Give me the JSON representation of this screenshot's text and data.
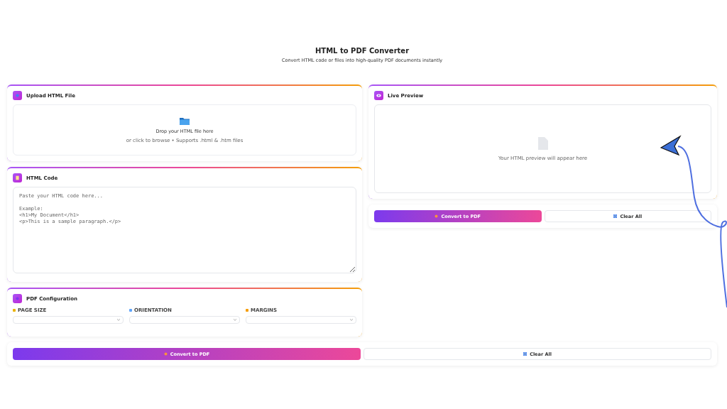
{
  "header": {
    "title": "HTML to PDF Converter",
    "subtitle": "Convert HTML code or files into high-quality PDF documents instantly"
  },
  "upload": {
    "title": "Upload HTML File",
    "drop_text": "Drop your HTML file here",
    "hint": "or click to browse • Supports .html & .htm files"
  },
  "code": {
    "title": "HTML Code",
    "placeholder": "Paste your HTML code here...\n\nExample:\n<h1>My Document</h1>\n<p>This is a sample paragraph.</p>"
  },
  "config": {
    "title": "PDF Configuration",
    "fields": [
      {
        "label": "PAGE SIZE",
        "kind": "size"
      },
      {
        "label": "ORIENTATION",
        "kind": "orientation"
      },
      {
        "label": "MARGINS",
        "kind": "margins"
      }
    ]
  },
  "preview": {
    "title": "Live Preview",
    "empty_text": "Your HTML preview will appear here"
  },
  "side_actions": {
    "primary": "Convert to PDF",
    "secondary": "Clear All"
  },
  "bottom_actions": {
    "primary": "Convert to PDF",
    "secondary": "Clear All"
  }
}
